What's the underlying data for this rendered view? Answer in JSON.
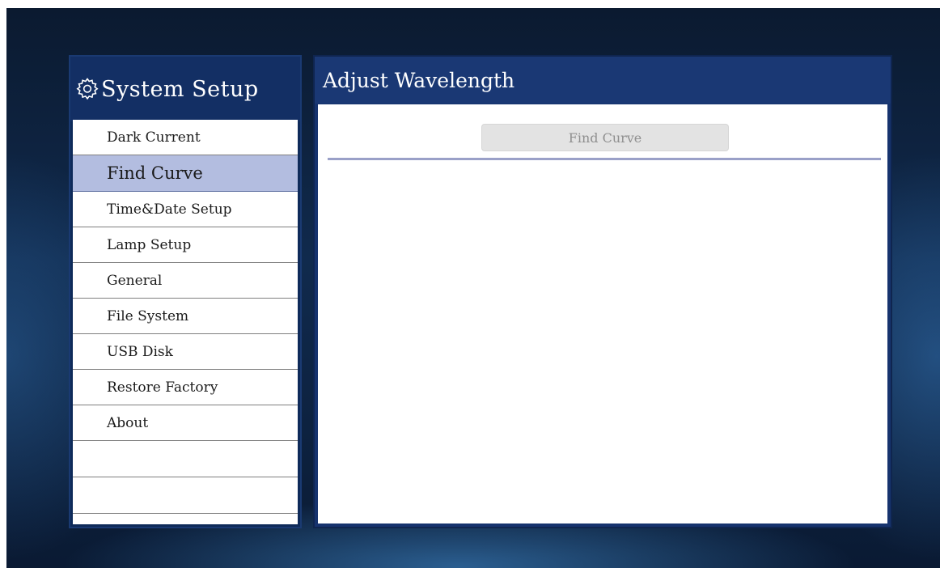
{
  "sidebar": {
    "title": "System Setup",
    "icon": "gear-icon",
    "items": [
      {
        "label": "Dark Current",
        "selected": false
      },
      {
        "label": "Find Curve",
        "selected": true
      },
      {
        "label": "Time&Date Setup",
        "selected": false
      },
      {
        "label": "Lamp Setup",
        "selected": false
      },
      {
        "label": "General",
        "selected": false
      },
      {
        "label": "File System",
        "selected": false
      },
      {
        "label": "USB Disk",
        "selected": false
      },
      {
        "label": "Restore Factory",
        "selected": false
      },
      {
        "label": "About",
        "selected": false
      }
    ]
  },
  "main": {
    "title": "Adjust Wavelength",
    "find_curve_button": "Find Curve"
  },
  "colors": {
    "header_blue": "#132f64",
    "selected_item": "#b3bde0",
    "divider": "#9aa0c8",
    "button_bg": "#e3e3e3",
    "button_text": "#8f8f8f"
  }
}
